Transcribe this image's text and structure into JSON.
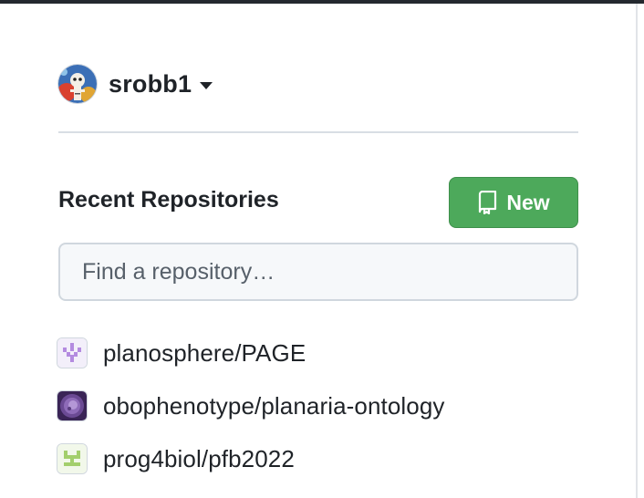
{
  "user": {
    "username": "srobb1",
    "avatar_icon": "user-avatar",
    "menu_icon": "caret-down-icon"
  },
  "repositories": {
    "title": "Recent Repositories",
    "new_button_label": "New",
    "new_button_icon": "repo-icon",
    "search_placeholder": "Find a repository…",
    "items": [
      {
        "name": "planosphere/PAGE",
        "icon": "identicon-purple"
      },
      {
        "name": "obophenotype/planaria-ontology",
        "icon": "org-avatar-purple"
      },
      {
        "name": "prog4biol/pfb2022",
        "icon": "identicon-green"
      }
    ]
  },
  "colors": {
    "accent_green": "#4da95b",
    "text": "#1f2328",
    "placeholder": "#57606a",
    "border": "#d0d7de"
  }
}
